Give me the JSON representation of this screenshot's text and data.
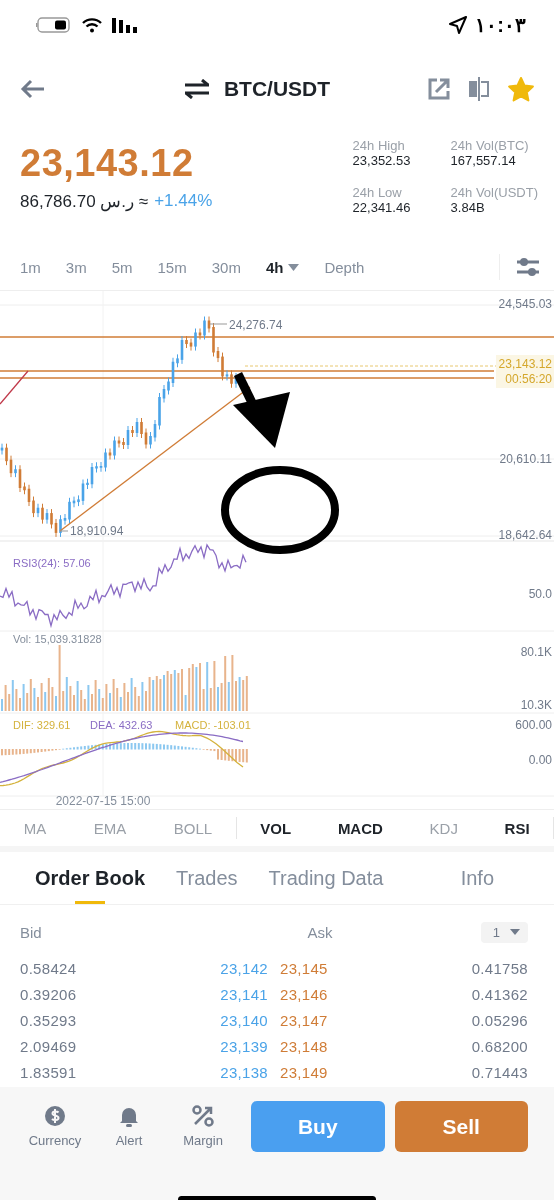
{
  "status_bar": {
    "time": "١٠:٠٣"
  },
  "header": {
    "title": "BTC/USDT",
    "favorite": true
  },
  "price": {
    "last": "23,143.12",
    "fiat": "86,786.70 ر.س ≈",
    "change": "+1.44%"
  },
  "stats": [
    {
      "label": "24h High",
      "value": "23,352.53"
    },
    {
      "label": "24h Vol(BTC)",
      "value": "167,557.14"
    },
    {
      "label": "24h Low",
      "value": "22,341.46"
    },
    {
      "label": "24h Vol(USDT)",
      "value": "3.84B"
    }
  ],
  "intervals": [
    {
      "label": "1m",
      "selected": false,
      "menu": false
    },
    {
      "label": "3m",
      "selected": false,
      "menu": false
    },
    {
      "label": "5m",
      "selected": false,
      "menu": false
    },
    {
      "label": "15m",
      "selected": false,
      "menu": false
    },
    {
      "label": "30m",
      "selected": false,
      "menu": false
    },
    {
      "label": "4h",
      "selected": true,
      "menu": true
    },
    {
      "label": "Depth",
      "selected": false,
      "menu": false
    }
  ],
  "chart": {
    "price_axis": [
      "24,545.03",
      "20,610.11",
      "18,642.64"
    ],
    "high_label": "24,276.74",
    "low_label": "18,910.94",
    "last_price": "23,143.12",
    "countdown": "00:56:20",
    "rsi": {
      "legend": "RSI3(24): 57.06",
      "axis": "50.0"
    },
    "volume": {
      "legend": "Vol: 15,039.31828",
      "axis": [
        "80.1K",
        "10.3K"
      ]
    },
    "macd": {
      "dif": "DIF: 329.61",
      "dea": "DEA: 432.63",
      "macd": "MACD: -103.01",
      "axis": [
        "600.00",
        "0.00"
      ]
    },
    "date": "2022-07-15 15:00"
  },
  "indicators": [
    {
      "label": "MA",
      "kind": "main",
      "on": false
    },
    {
      "label": "EMA",
      "kind": "main",
      "on": false
    },
    {
      "label": "BOLL",
      "kind": "main",
      "on": false
    },
    {
      "label": "VOL",
      "kind": "sub",
      "on": true
    },
    {
      "label": "MACD",
      "kind": "sub",
      "on": true
    },
    {
      "label": "KDJ",
      "kind": "sub",
      "on": false
    },
    {
      "label": "RSI",
      "kind": "sub",
      "on": true
    }
  ],
  "tabs": [
    {
      "label": "Order Book",
      "selected": true
    },
    {
      "label": "Trades",
      "selected": false
    },
    {
      "label": "Trading Data",
      "selected": false
    },
    {
      "label": "Info",
      "selected": false
    }
  ],
  "order_book": {
    "bid_header": "Bid",
    "ask_header": "Ask",
    "precision": "1",
    "rows": [
      {
        "bid_qty": "0.58424",
        "bid_price": "23,142",
        "ask_price": "23,145",
        "ask_qty": "0.41758"
      },
      {
        "bid_qty": "0.39206",
        "bid_price": "23,141",
        "ask_price": "23,146",
        "ask_qty": "0.41362"
      },
      {
        "bid_qty": "0.35293",
        "bid_price": "23,140",
        "ask_price": "23,147",
        "ask_qty": "0.05296"
      },
      {
        "bid_qty": "2.09469",
        "bid_price": "23,139",
        "ask_price": "23,148",
        "ask_qty": "0.68200"
      },
      {
        "bid_qty": "1.83591",
        "bid_price": "23,138",
        "ask_price": "23,149",
        "ask_qty": "0.71443"
      }
    ]
  },
  "bottom_bar": {
    "actions": [
      {
        "label": "Currency",
        "kind": "currency"
      },
      {
        "label": "Alert",
        "kind": "alert"
      },
      {
        "label": "Margin",
        "kind": "margin"
      }
    ],
    "buttons": [
      {
        "label": "Buy",
        "kind": "buy"
      },
      {
        "label": "Sell",
        "kind": "sell"
      }
    ]
  }
}
